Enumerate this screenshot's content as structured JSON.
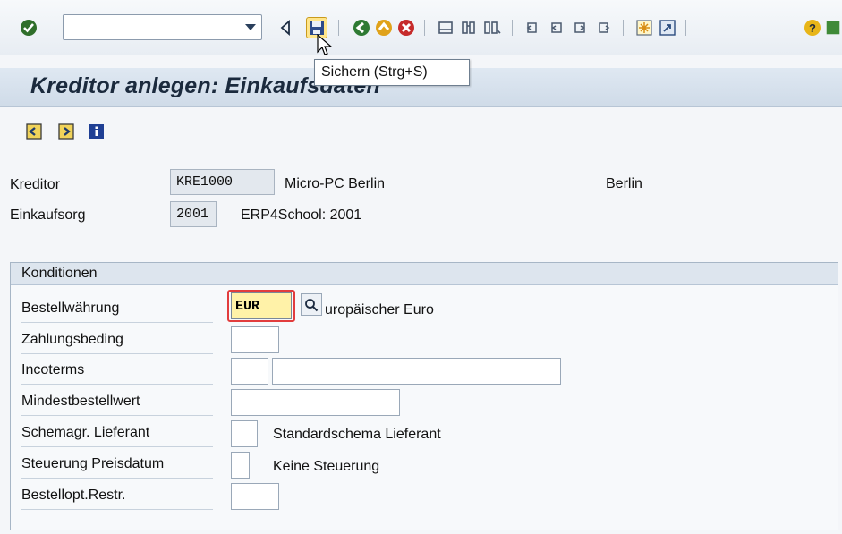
{
  "toolbar": {
    "command_field_value": "",
    "tooltip": "Sichern   (Strg+S)",
    "icons": [
      "enter-check-icon",
      "command-dropdown-icon",
      "collapse-triangle-icon",
      "save-icon",
      "back-icon",
      "exit-icon",
      "cancel-icon",
      "print-icon",
      "find-icon",
      "find-next-icon",
      "first-page-icon",
      "previous-page-icon",
      "next-page-icon",
      "last-page-icon",
      "new-session-icon",
      "shortcut-icon",
      "help-icon",
      "layout-menu-icon"
    ]
  },
  "title": "Kreditor anlegen: Einkaufsdaten",
  "app_toolbar": {
    "icons": [
      "previous-screen-icon",
      "next-screen-icon",
      "info-icon"
    ]
  },
  "header": {
    "kreditor_label": "Kreditor",
    "kreditor_value": "KRE1000",
    "kreditor_name": "Micro-PC Berlin",
    "kreditor_city": "Berlin",
    "einkaufsorg_label": "Einkaufsorg",
    "einkaufsorg_value": "2001",
    "einkaufsorg_name": "ERP4School: 2001"
  },
  "conditions": {
    "title": "Konditionen",
    "rows": [
      {
        "label": "Bestellwährung",
        "value": "EUR",
        "description": "uropäischer Euro"
      },
      {
        "label": "Zahlungsbeding",
        "value": ""
      },
      {
        "label": "Incoterms",
        "value": "",
        "value2": ""
      },
      {
        "label": "Mindestbestellwert",
        "value": ""
      },
      {
        "label": "Schemagr. Lieferant",
        "value": "",
        "description": "Standardschema Lieferant"
      },
      {
        "label": "Steuerung Preisdatum",
        "value": "",
        "description": "Keine Steuerung"
      },
      {
        "label": "Bestellopt.Restr.",
        "value": ""
      }
    ]
  },
  "colors": {
    "required_field": "#fff2a8",
    "required_marker": "#e23d3d",
    "title_background": "#cfdbe8"
  }
}
